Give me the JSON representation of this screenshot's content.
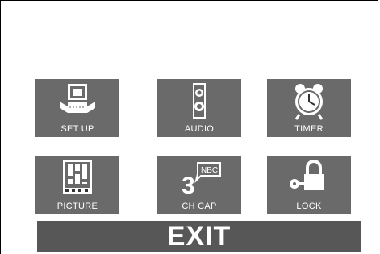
{
  "menu": {
    "tiles": [
      {
        "label": "SET UP",
        "icon": "tv-setup-icon"
      },
      {
        "label": "AUDIO",
        "icon": "speaker-icon"
      },
      {
        "label": "TIMER",
        "icon": "alarm-clock-icon"
      },
      {
        "label": "PICTURE",
        "icon": "picture-adjust-icon"
      },
      {
        "label": "CH CAP",
        "icon": "channel-caption-icon"
      },
      {
        "label": "LOCK",
        "icon": "key-lock-icon"
      }
    ],
    "exit_label": "EXIT",
    "channel_icon_text": {
      "number": "3",
      "network": "NBC"
    }
  },
  "colors": {
    "tile_bg": "#6a6a6a",
    "exit_bg": "#575757",
    "text": "#ffffff",
    "background": "#ffffff"
  }
}
